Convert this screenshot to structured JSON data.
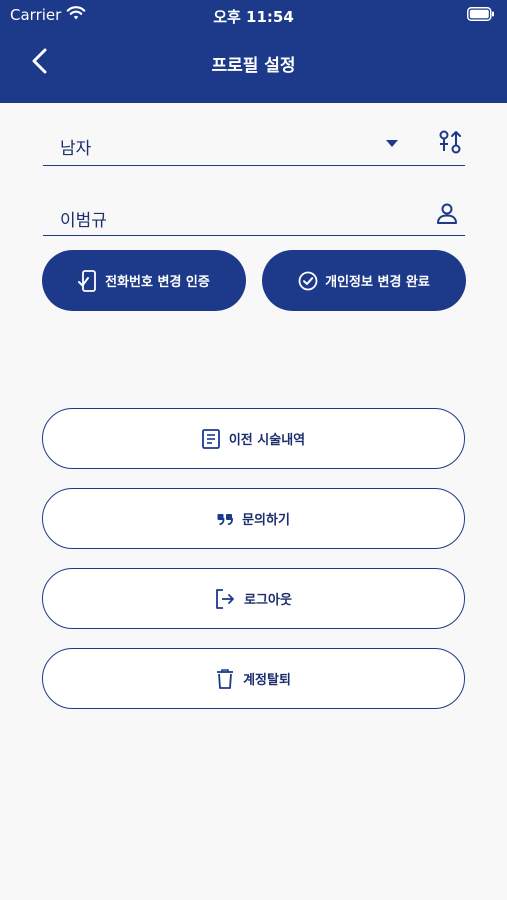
{
  "status_bar": {
    "carrier": "Carrier",
    "time": "오후 11:54"
  },
  "nav": {
    "title": "프로필 설정",
    "back_icon": "chevron-left-icon"
  },
  "form": {
    "gender_value": "남자",
    "name_value": "이범규"
  },
  "actions": {
    "phone_verify_label": "전화번호 변경 인증",
    "save_label": "개인정보 변경 완료"
  },
  "menu": {
    "history_label": "이전 시술내역",
    "inquiry_label": "문의하기",
    "logout_label": "로그아웃",
    "withdraw_label": "계정탈퇴"
  },
  "colors": {
    "primary": "#1d3a8a",
    "background": "#f8f8f8",
    "button_text": "#ffffff"
  }
}
